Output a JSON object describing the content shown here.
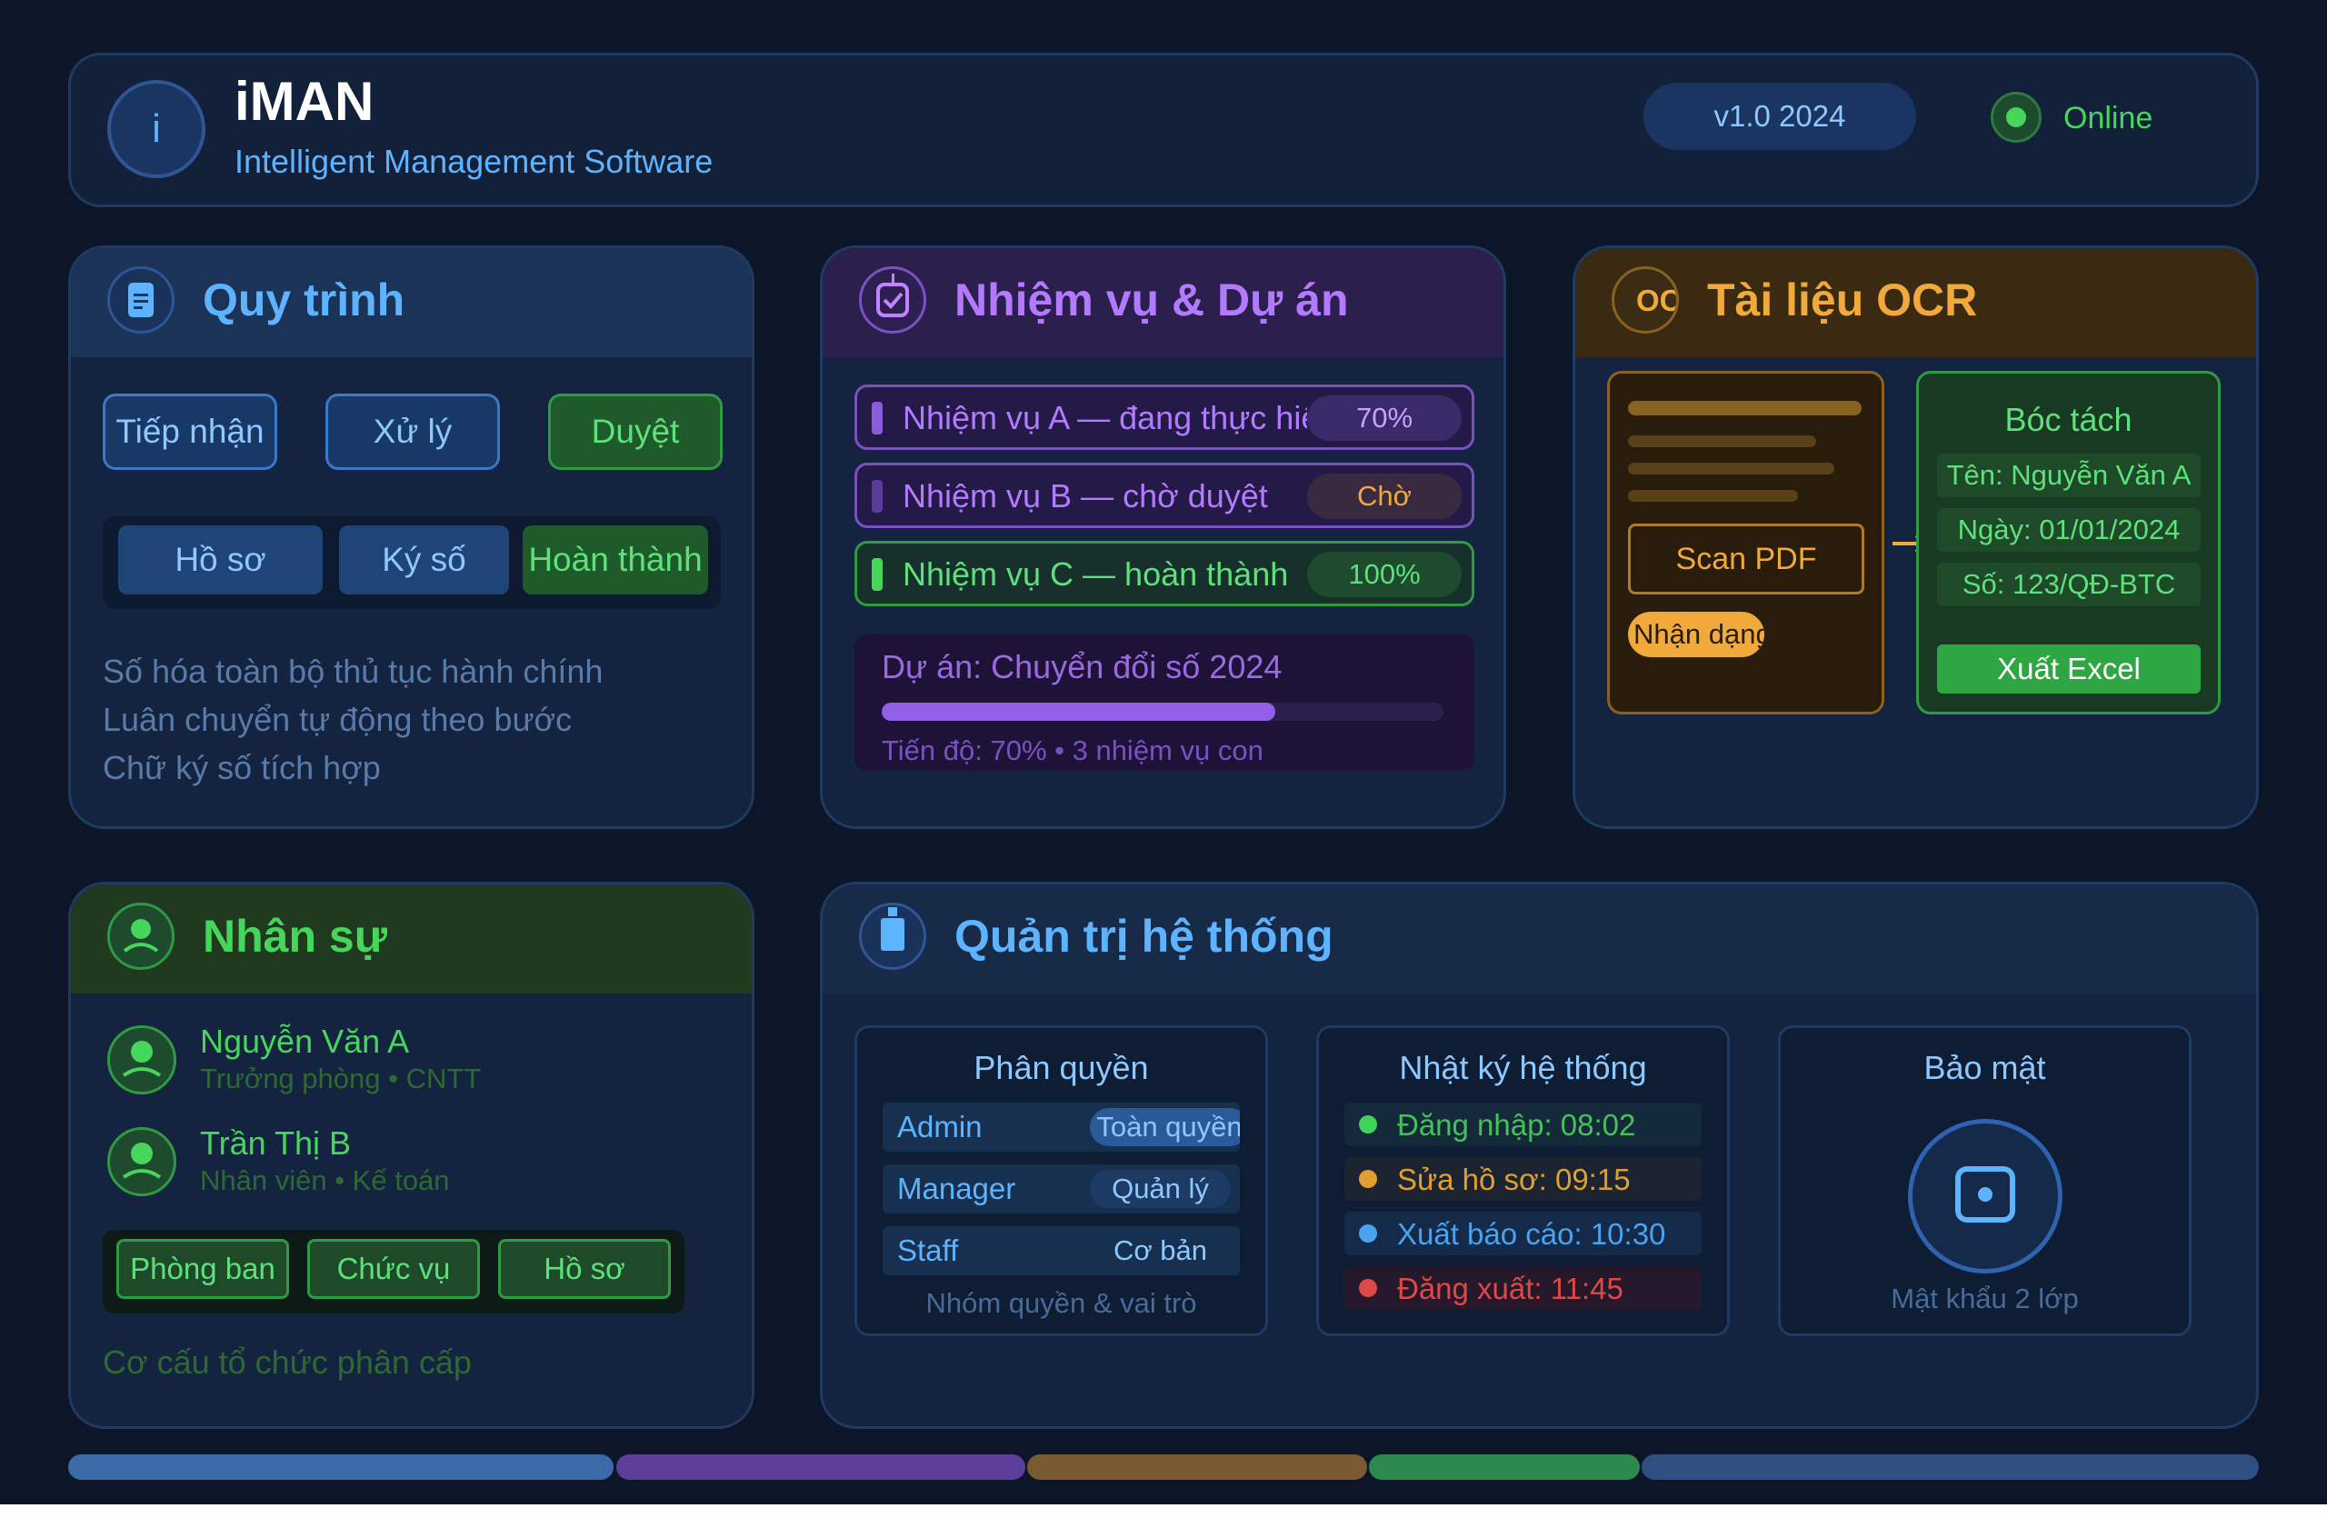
{
  "header": {
    "logo_letter": "i",
    "title": "iMAN",
    "subtitle": "Intelligent Management Software",
    "version": "v1.0 2024",
    "status": "Online"
  },
  "workflow": {
    "title": "Quy trình",
    "steps": [
      "Tiếp nhận",
      "Xử lý",
      "Duyệt"
    ],
    "tabs": [
      "Hồ sơ",
      "Ký số",
      "Hoàn thành"
    ],
    "features": [
      "Số hóa toàn bộ thủ tục hành chính",
      "Luân chuyển tự động theo bước",
      "Chữ ký số tích hợp"
    ]
  },
  "tasks": {
    "title": "Nhiệm vụ & Dự án",
    "items": [
      {
        "label": "Nhiệm vụ A — đang thực hiện",
        "badge": "70%"
      },
      {
        "label": "Nhiệm vụ B — chờ duyệt",
        "badge": "Chờ"
      },
      {
        "label": "Nhiệm vụ C — hoàn thành",
        "badge": "100%"
      }
    ],
    "project": {
      "title": "Dự án: Chuyển đổi số 2024",
      "progress": 70,
      "caption": "Tiến độ: 70% • 3 nhiệm vụ con"
    }
  },
  "ocr": {
    "title": "Tài liệu OCR",
    "icon_text": "OCR",
    "scan_label": "Scan PDF",
    "recognize_label": "Nhận dạng",
    "extract": {
      "title": "Bóc tách",
      "fields": [
        "Tên: Nguyễn Văn A",
        "Ngày: 01/01/2024",
        "Số: 123/QĐ-BTC"
      ],
      "export_label": "Xuất Excel"
    }
  },
  "hr": {
    "title": "Nhân sự",
    "people": [
      {
        "name": "Nguyễn Văn A",
        "role": "Trưởng phòng • CNTT"
      },
      {
        "name": "Trần Thị B",
        "role": "Nhân viên • Kế toán"
      }
    ],
    "tabs": [
      "Phòng ban",
      "Chức vụ",
      "Hồ sơ"
    ],
    "footer": "Cơ cấu tổ chức phân cấp"
  },
  "admin": {
    "title": "Quản trị hệ thống",
    "permissions": {
      "title": "Phân quyền",
      "rows": [
        {
          "role": "Admin",
          "level": "Toàn quyền"
        },
        {
          "role": "Manager",
          "level": "Quản lý"
        },
        {
          "role": "Staff",
          "level": "Cơ bản"
        }
      ],
      "caption": "Nhóm quyền & vai trò"
    },
    "log": {
      "title": "Nhật ký hệ thống",
      "entries": [
        {
          "text": "Đăng nhập: 08:02",
          "color": "#3fd35a"
        },
        {
          "text": "Sửa hồ sơ: 09:15",
          "color": "#e0a030"
        },
        {
          "text": "Xuất báo cáo: 10:30",
          "color": "#4aa3ee"
        },
        {
          "text": "Đăng xuất: 11:45",
          "color": "#e04848"
        }
      ]
    },
    "security": {
      "title": "Bảo mật",
      "caption": "Mật khẩu 2 lớp"
    }
  },
  "colors": {
    "background": "#0d1628",
    "blue": "#5eb3ff",
    "purple": "#b37aff",
    "amber": "#f0a93a",
    "green": "#46d65c"
  }
}
